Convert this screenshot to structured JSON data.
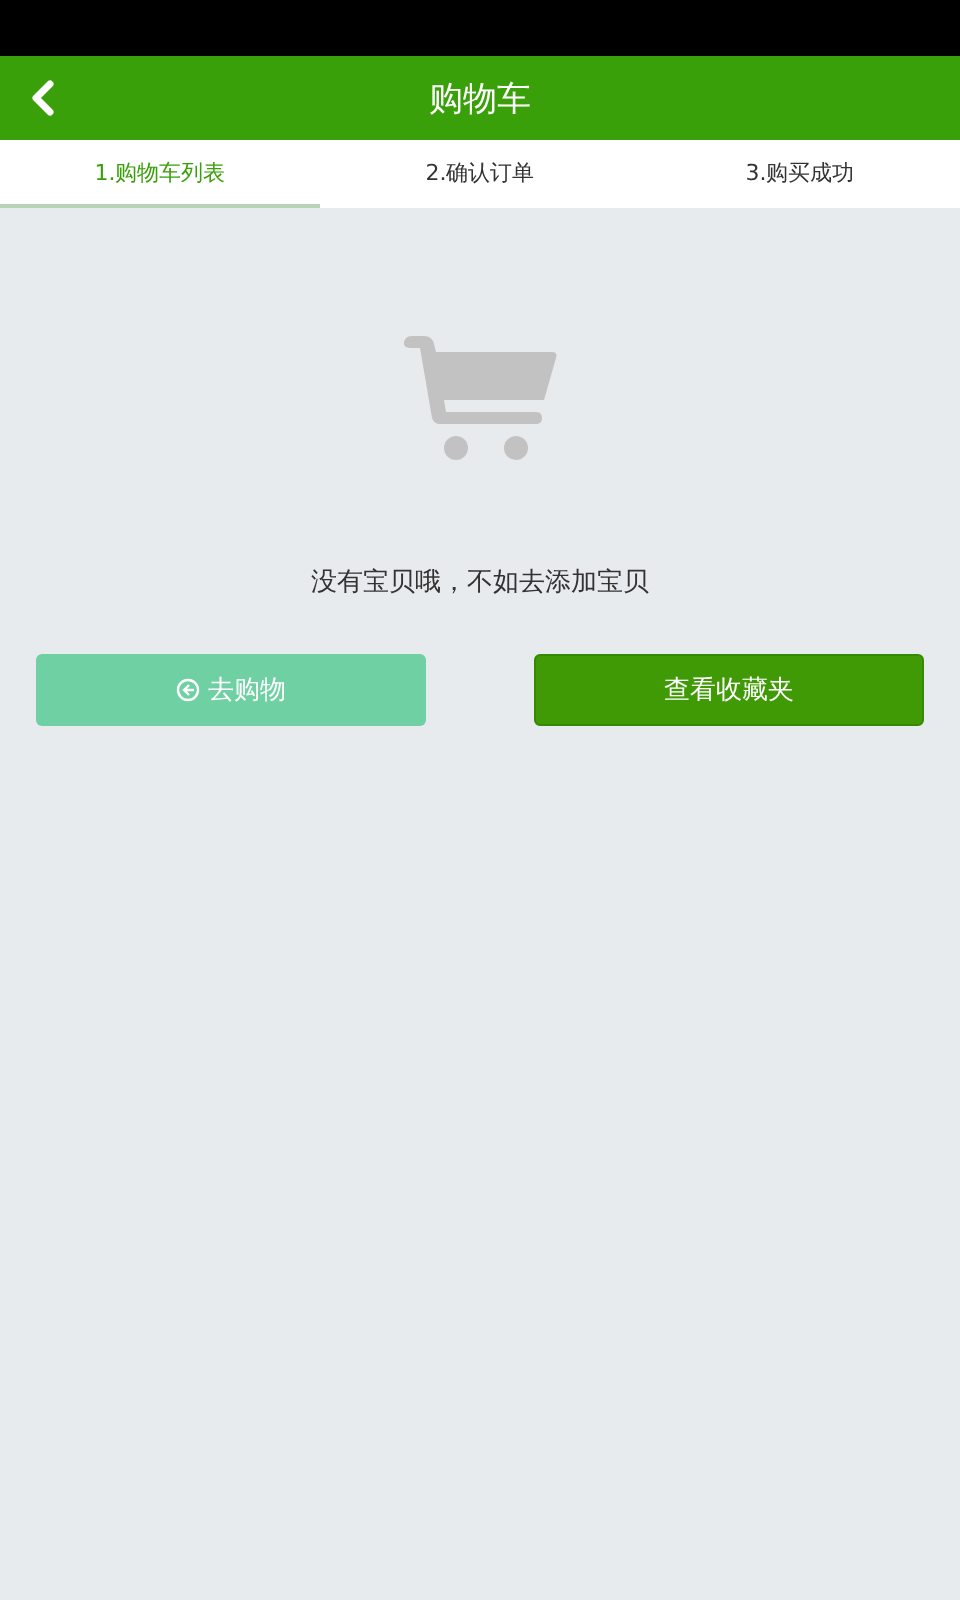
{
  "header": {
    "title": "购物车"
  },
  "steps": [
    {
      "label": "1.购物车列表",
      "selected": true
    },
    {
      "label": "2.确认订单",
      "selected": false
    },
    {
      "label": "3.购买成功",
      "selected": false
    }
  ],
  "empty_message": "没有宝贝哦，不如去添加宝贝",
  "buttons": [
    {
      "label": "去购物",
      "kind": "light"
    },
    {
      "label": "查看收藏夹",
      "kind": "dark"
    }
  ]
}
